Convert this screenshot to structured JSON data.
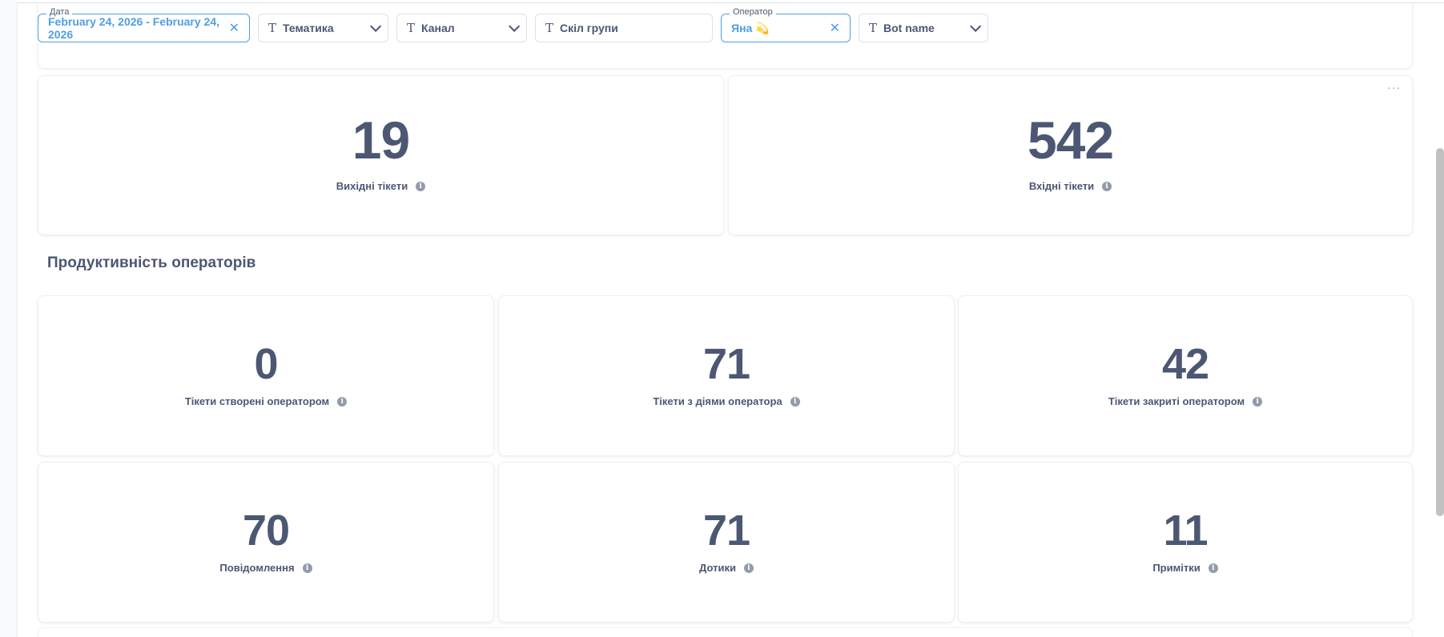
{
  "filters": {
    "date": {
      "legend": "Дата",
      "value": "February 24, 2026 - February 24, 2026",
      "clear": "✕"
    },
    "topic": {
      "label": "Тематика"
    },
    "channel": {
      "label": "Канал"
    },
    "group": {
      "placeholder": "Скіл групи"
    },
    "operator": {
      "legend": "Оператор",
      "value": "Яна 💫",
      "clear": "✕"
    },
    "bot": {
      "label": "Bot name"
    }
  },
  "top_metrics": [
    {
      "value": "19",
      "label": "Вихідні тікети"
    },
    {
      "value": "542",
      "label": "Вхідні тікети"
    }
  ],
  "more_menu": "···",
  "section": {
    "title": "Продуктивність операторів"
  },
  "metrics": [
    {
      "value": "0",
      "label": "Тікети створені оператором"
    },
    {
      "value": "71",
      "label": "Тікети з діями оператора"
    },
    {
      "value": "42",
      "label": "Тікети закриті оператором"
    },
    {
      "value": "70",
      "label": "Повідомлення"
    },
    {
      "value": "71",
      "label": "Дотики"
    },
    {
      "value": "11",
      "label": "Примітки"
    }
  ],
  "colors": {
    "accent": "#509ee3",
    "text": "#4c5773"
  }
}
